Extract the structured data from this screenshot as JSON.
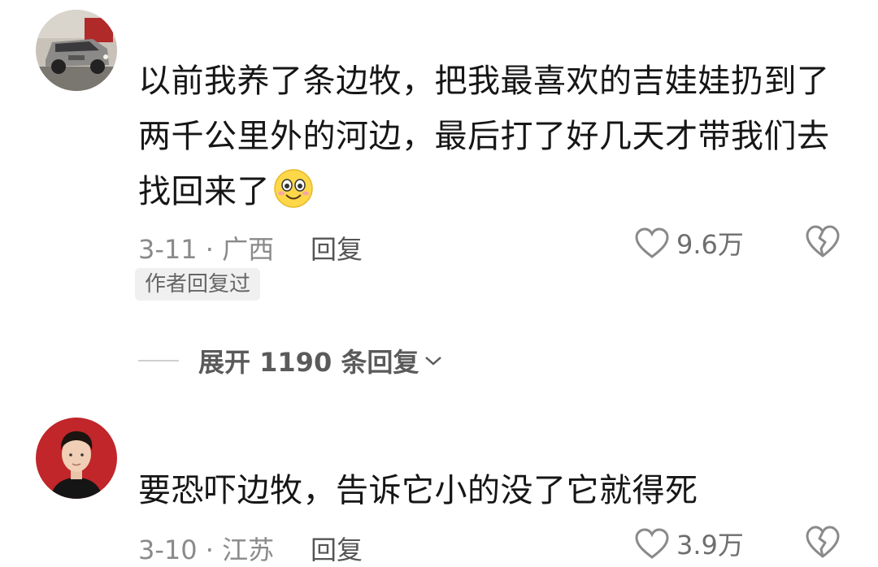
{
  "comments": [
    {
      "avatar": "car-avatar",
      "text_lines": [
        "以前我养了条边牧，把我最喜欢的吉娃娃扔到了",
        "两千公里外的河边，最后打了好几天才带我们去",
        "找回来了"
      ],
      "emoji": "smile-face-icon",
      "date_location": "3-11 · 广西",
      "reply_label": "回复",
      "likes": "9.6万",
      "author_tag": "作者回复过",
      "expand_label": "展开 1190 条回复"
    },
    {
      "avatar": "man-portrait-avatar",
      "text": "要恐吓边牧，告诉它小的没了它就得死",
      "date_location": "3-10 · 江苏",
      "reply_label": "回复",
      "likes": "3.9万"
    }
  ],
  "colors": {
    "text": "#161616",
    "meta": "#8a8a8a",
    "tag_bg": "#f0f0f0"
  }
}
